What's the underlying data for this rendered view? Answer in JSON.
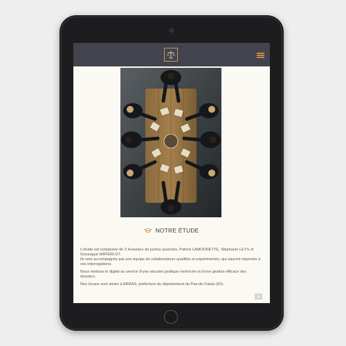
{
  "section": {
    "title": "NOTRE ÉTUDE"
  },
  "content": {
    "paragraph1_line1": "L'étude est composée de 3 Huissiers de justice associés, Patrick LAMOURETTE, Stéphanie LEYS et Gonzague WATERLOT.",
    "paragraph1_line2": "Ils sont accompagnés par une équipe de collaborateurs qualifiés et expérimentés, qui sauront répondre à vos interrogations.",
    "paragraph2": "Nous mettons le digital au service d'une sécurité juridique renforcée et d'une gestion efficace des dossiers.",
    "paragraph3": "Nos locaux sont situés à ARRAS, préfecture du département du Pas-de-Calais (62)."
  },
  "icons": {
    "logo": "scales-of-justice-logo",
    "menu": "hamburger-menu-icon",
    "section": "graduation-cap-icon",
    "scroll": "chevron-up-icon"
  },
  "colors": {
    "header": "#43434d",
    "accent": "#c6893f",
    "page_background": "#fbf9f4",
    "device": "#1d1d1f"
  }
}
